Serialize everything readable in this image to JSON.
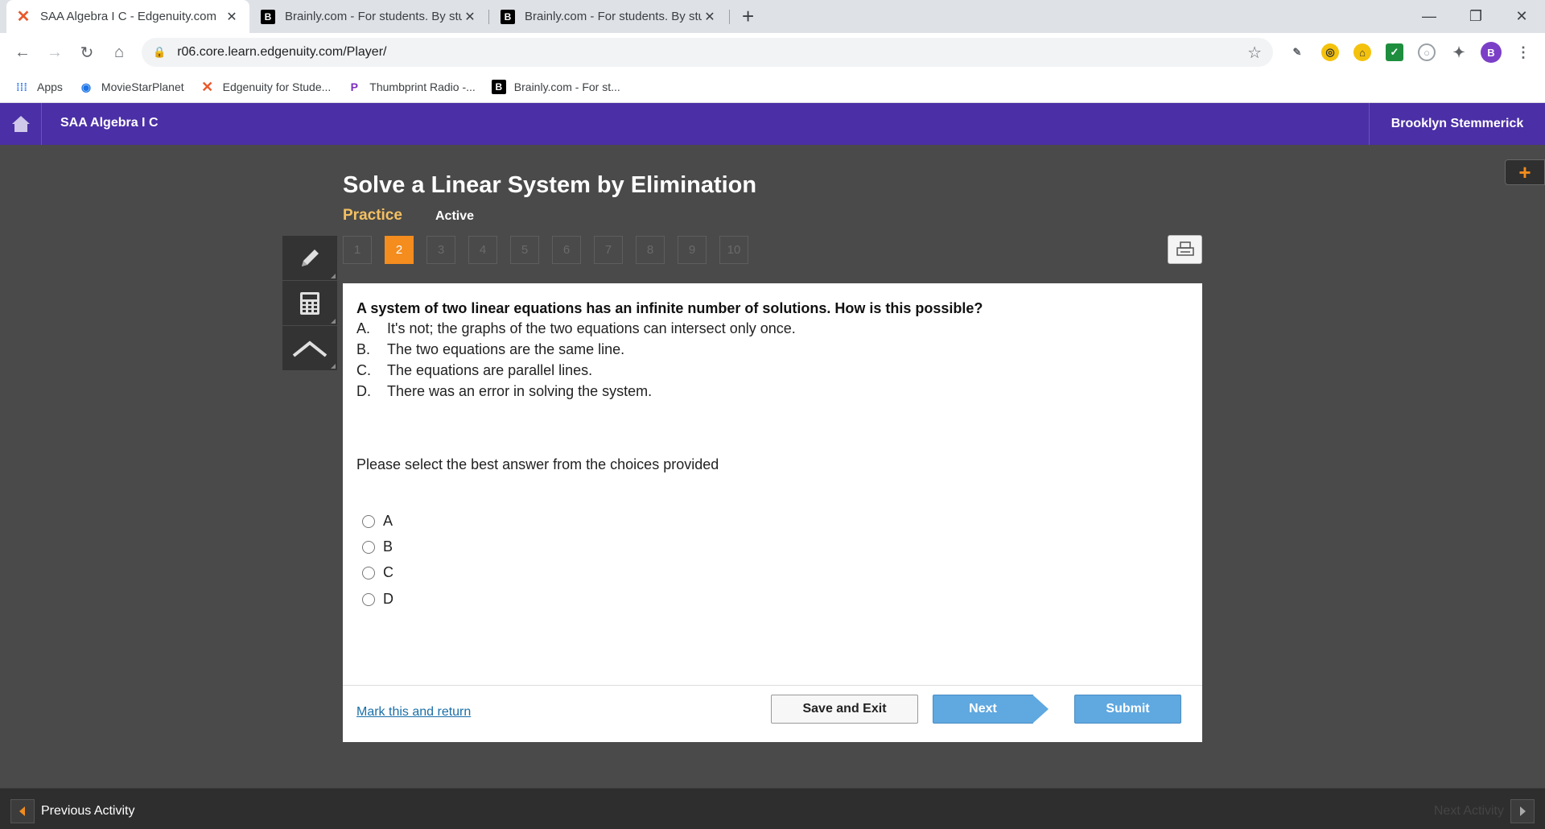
{
  "browser": {
    "tabs": [
      {
        "title": "SAA Algebra I C - Edgenuity.com",
        "icon": "edgenuity-icon"
      },
      {
        "title": "Brainly.com - For students. By stu",
        "icon": "brainly-icon"
      },
      {
        "title": "Brainly.com - For students. By stu",
        "icon": "brainly-icon"
      }
    ],
    "url": "r06.core.learn.edgenuity.com/Player/",
    "profile_initial": "B",
    "bookmarks": [
      {
        "label": "Apps",
        "icon": "apps-grid-icon"
      },
      {
        "label": "MovieStarPlanet",
        "icon": "moviestarplanet-icon"
      },
      {
        "label": "Edgenuity for Stude...",
        "icon": "edgenuity-icon"
      },
      {
        "label": "Thumbprint Radio -...",
        "icon": "pandora-icon"
      },
      {
        "label": "Brainly.com - For st...",
        "icon": "brainly-icon"
      }
    ]
  },
  "header": {
    "course": "SAA Algebra I C",
    "user": "Brooklyn Stemmerick"
  },
  "lesson": {
    "title": "Solve a Linear System by Elimination",
    "activity_type": "Practice",
    "status": "Active"
  },
  "question_nav": {
    "numbers": [
      "1",
      "2",
      "3",
      "4",
      "5",
      "6",
      "7",
      "8",
      "9",
      "10"
    ],
    "current": "2"
  },
  "question": {
    "text": "A system of two linear equations has an infinite number of solutions. How is this possible?",
    "choices": [
      {
        "letter": "A.",
        "text": "It's not; the graphs of the two equations can intersect only once."
      },
      {
        "letter": "B.",
        "text": "The two equations are the same line."
      },
      {
        "letter": "C.",
        "text": "The equations are parallel lines."
      },
      {
        "letter": "D.",
        "text": "There was an error in solving the system."
      }
    ],
    "prompt": "Please select the best answer from the choices provided",
    "options": [
      "A",
      "B",
      "C",
      "D"
    ]
  },
  "actions": {
    "mark": "Mark this and return",
    "save": "Save and Exit",
    "next": "Next",
    "submit": "Submit"
  },
  "footer": {
    "previous": "Previous Activity",
    "next": "Next Activity"
  },
  "colors": {
    "header_purple": "#4b2fa6",
    "accent_orange": "#f48c1e",
    "button_blue": "#5fa8e0"
  }
}
